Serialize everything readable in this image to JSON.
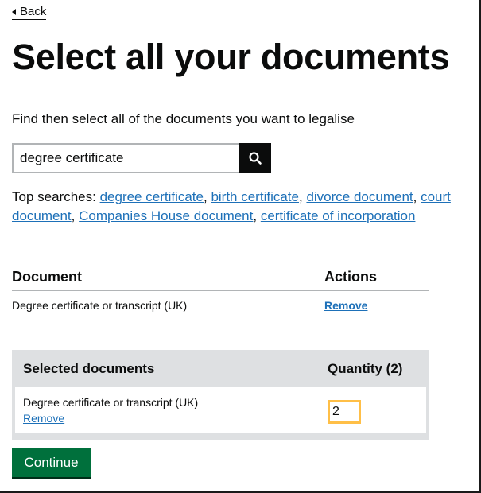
{
  "back_link": {
    "label": "Back"
  },
  "page_title": "Select all your documents",
  "hint": "Find then select all of the documents you want to legalise",
  "search": {
    "value": "degree certificate",
    "button_icon": "search-icon"
  },
  "top_searches": {
    "label": "Top searches:",
    "items": [
      "degree certificate",
      "birth certificate",
      "divorce document",
      "court document",
      "Companies House document",
      "certificate of incorporation"
    ]
  },
  "documents_table": {
    "headers": {
      "document": "Document",
      "actions": "Actions"
    },
    "rows": [
      {
        "name": "Degree certificate or transcript (UK)",
        "action": "Remove"
      }
    ]
  },
  "selected": {
    "headers": {
      "title": "Selected documents",
      "quantity": "Quantity (2)"
    },
    "items": [
      {
        "name": "Degree certificate or transcript (UK)",
        "remove": "Remove",
        "quantity": "2"
      }
    ]
  },
  "continue_label": "Continue",
  "colors": {
    "link": "#1d70b8",
    "text": "#0b0c0c",
    "button_green": "#00703c",
    "focus_yellow": "#ffbf47",
    "panel_grey": "#dee0e2"
  }
}
